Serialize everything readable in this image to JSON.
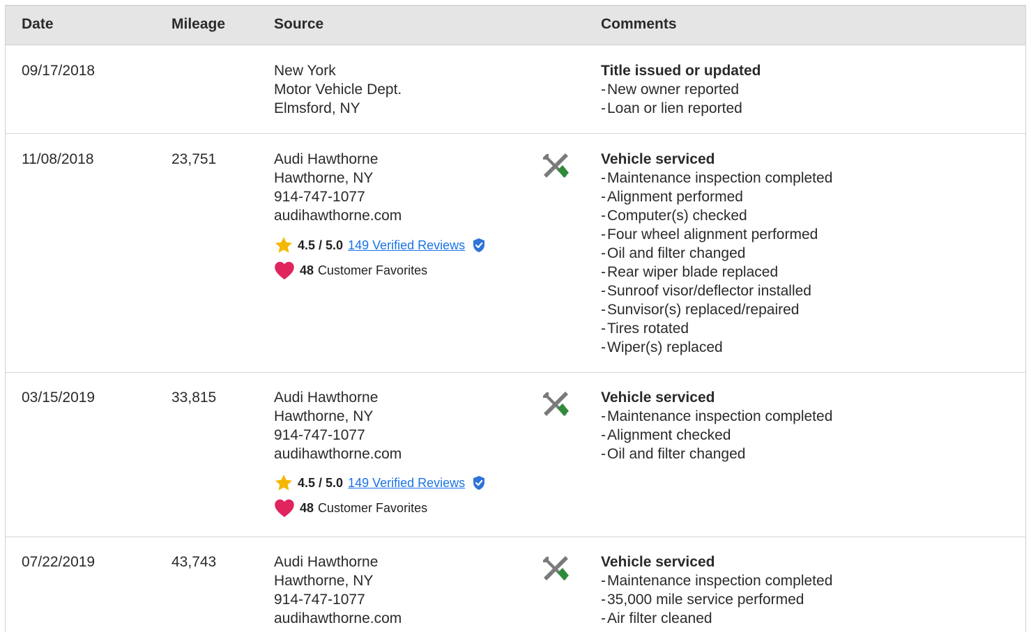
{
  "table": {
    "headers": {
      "date": "Date",
      "mileage": "Mileage",
      "source": "Source",
      "comments": "Comments"
    },
    "rows": [
      {
        "date": "09/17/2018",
        "mileage": "",
        "source_lines": [
          "New York",
          "Motor Vehicle Dept.",
          "Elmsford, NY"
        ],
        "comment_title": "Title issued or updated",
        "comment_items": [
          "New owner reported",
          "Loan or lien reported"
        ]
      },
      {
        "date": "11/08/2018",
        "mileage": "23,751",
        "source_lines": [
          "Audi Hawthorne",
          "Hawthorne, NY",
          "914-747-1077",
          "audihawthorne.com"
        ],
        "rating_score": "4.5 / 5.0",
        "reviews_link": "149 Verified Reviews",
        "favorites_count": "48",
        "favorites_label": "Customer Favorites",
        "comment_title": "Vehicle serviced",
        "comment_items": [
          "Maintenance inspection completed",
          "Alignment performed",
          "Computer(s) checked",
          "Four wheel alignment performed",
          "Oil and filter changed",
          "Rear wiper blade replaced",
          "Sunroof visor/deflector installed",
          "Sunvisor(s) replaced/repaired",
          "Tires rotated",
          "Wiper(s) replaced"
        ]
      },
      {
        "date": "03/15/2019",
        "mileage": "33,815",
        "source_lines": [
          "Audi Hawthorne",
          "Hawthorne, NY",
          "914-747-1077",
          "audihawthorne.com"
        ],
        "rating_score": "4.5 / 5.0",
        "reviews_link": "149 Verified Reviews",
        "favorites_count": "48",
        "favorites_label": "Customer Favorites",
        "comment_title": "Vehicle serviced",
        "comment_items": [
          "Maintenance inspection completed",
          "Alignment checked",
          "Oil and filter changed"
        ]
      },
      {
        "date": "07/22/2019",
        "mileage": "43,743",
        "source_lines": [
          "Audi Hawthorne",
          "Hawthorne, NY",
          "914-747-1077",
          "audihawthorne.com"
        ],
        "comment_title": "Vehicle serviced",
        "comment_items": [
          "Maintenance inspection completed",
          "35,000 mile service performed",
          "Air filter cleaned"
        ]
      }
    ]
  },
  "colors": {
    "header_bg": "#e5e5e5",
    "link": "#1a73e8",
    "star": "#f5b800",
    "heart": "#e0245e",
    "shield": "#2f73d9",
    "wrench": "#7a7a7a",
    "screwdriver_handle": "#2e8b3a"
  },
  "icons": {
    "service": "wrench-screwdriver-icon",
    "rating": "star-icon",
    "verified": "verified-shield-icon",
    "favorites": "heart-icon"
  }
}
